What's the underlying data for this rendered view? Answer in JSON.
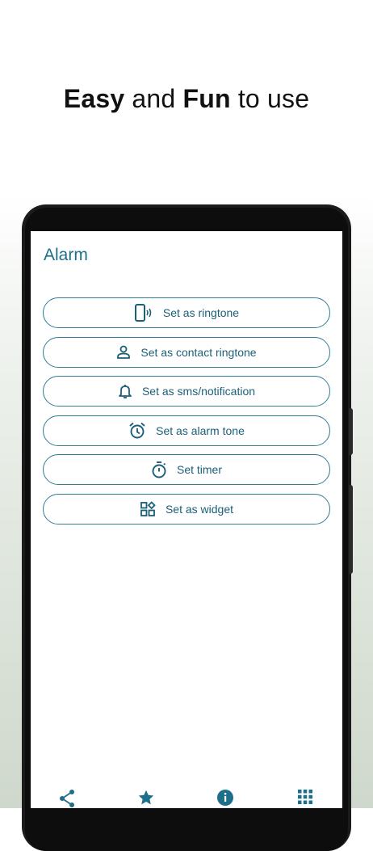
{
  "headline": {
    "bold1": "Easy",
    "mid": " and ",
    "bold2": "Fun",
    "end": " to use"
  },
  "screen": {
    "title": "Alarm",
    "buttons": [
      {
        "label": "Set as ringtone",
        "icon": "phone-ring-icon"
      },
      {
        "label": "Set as contact ringtone",
        "icon": "person-icon"
      },
      {
        "label": "Set as sms/notification",
        "icon": "bell-icon"
      },
      {
        "label": "Set as alarm tone",
        "icon": "alarm-clock-icon"
      },
      {
        "label": "Set timer",
        "icon": "timer-icon"
      },
      {
        "label": "Set as widget",
        "icon": "widget-icon"
      }
    ],
    "bottom_nav": [
      "share-icon",
      "star-icon",
      "info-icon",
      "apps-grid-icon"
    ]
  },
  "colors": {
    "accent": "#1e6f8a",
    "border": "#2f7f97"
  }
}
